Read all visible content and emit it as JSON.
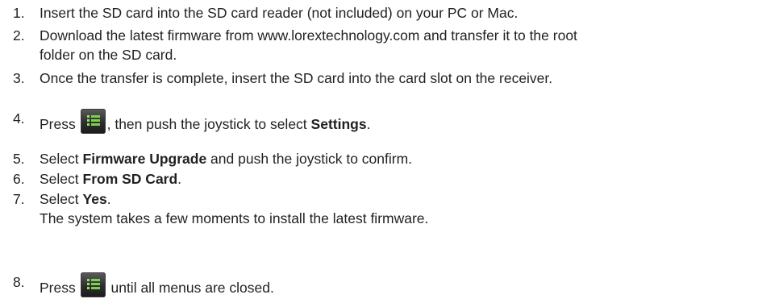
{
  "steps": [
    {
      "number": "1.",
      "text": "Insert the SD card into the SD card reader (not included) on your PC or Mac."
    },
    {
      "number": "2.",
      "line1": "Download the latest firmware from www.lorextechnology.com and transfer it to the root",
      "line2": "folder on the SD card."
    },
    {
      "number": "3.",
      "text": "Once the transfer is complete, insert the SD card into the card slot on the receiver."
    },
    {
      "number": "4.",
      "pre": "Press",
      "post": ", then push the joystick to select",
      "bold": "Settings",
      "end": "."
    },
    {
      "number": "5.",
      "pre": "Select",
      "bold": "Firmware Upgrade",
      "post": "and push the joystick to confirm."
    },
    {
      "number": "6.",
      "pre": "Select",
      "bold": "From SD Card",
      "end": "."
    },
    {
      "number": "7.",
      "pre": "Select",
      "bold": "Yes",
      "end": ".",
      "note": "The system takes a few moments to install the latest firmware."
    },
    {
      "number": "8.",
      "pre": "Press",
      "post": "until all menus are closed."
    }
  ],
  "icons": {
    "menu_button": "menu-icon"
  }
}
